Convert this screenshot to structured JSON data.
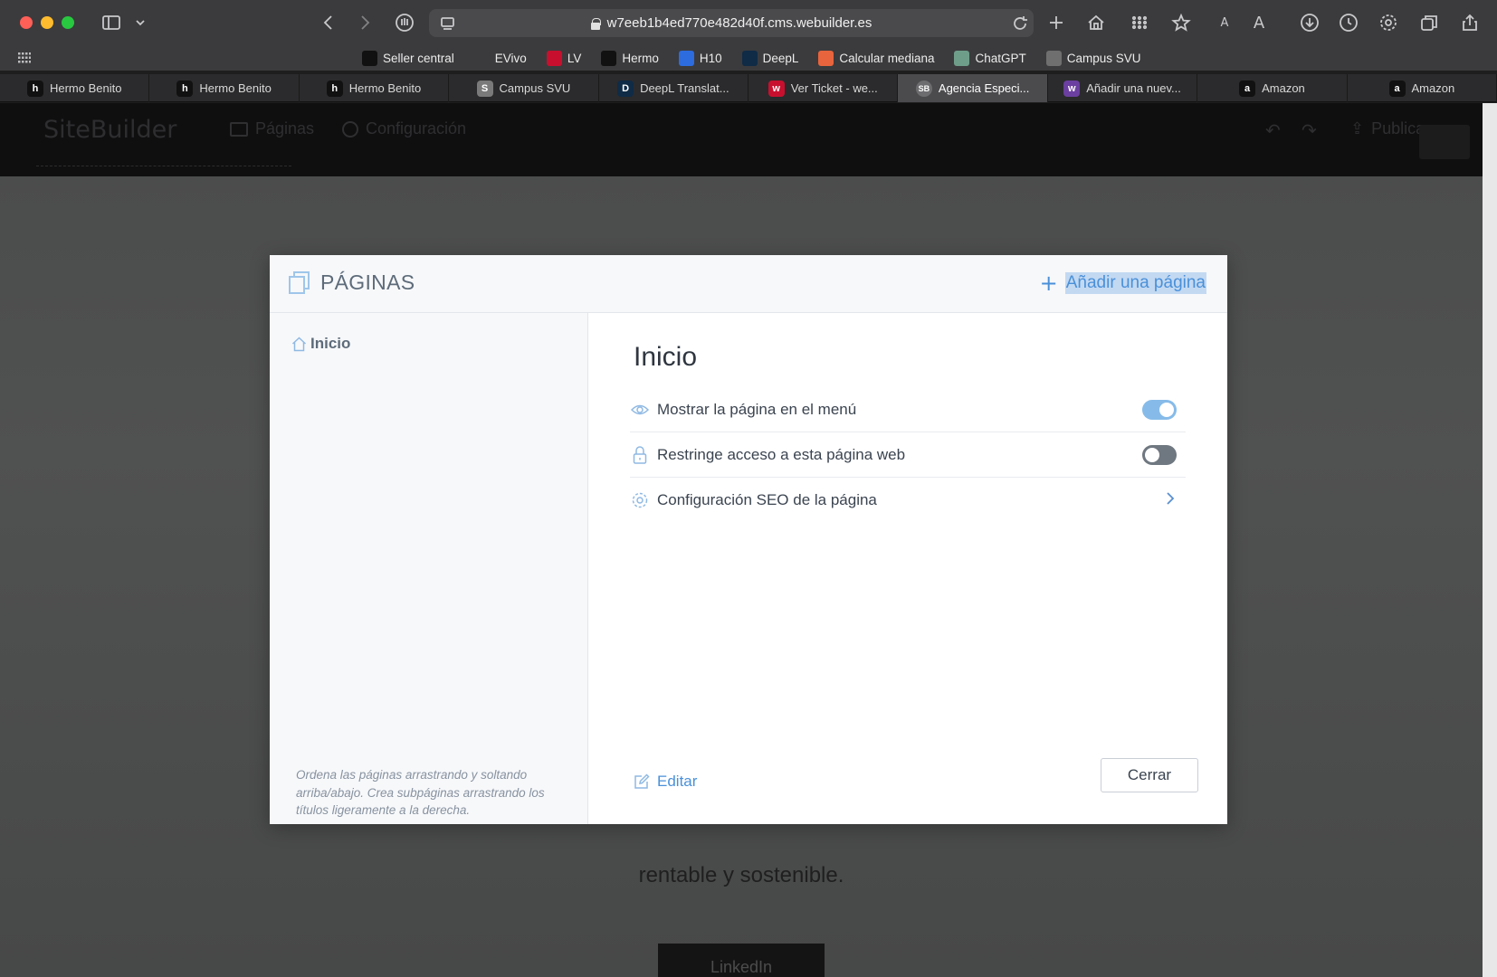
{
  "browser": {
    "url": "w7eeb1b4ed770e482d40f.cms.webuilder.es",
    "bookmarks": [
      {
        "label": "Seller central",
        "icon": "amazon-icon",
        "color": "#111111"
      },
      {
        "label": "EVivo",
        "icon": "globe-icon",
        "color": "#3b3b3d"
      },
      {
        "label": "LV",
        "icon": "lv-icon",
        "color": "#c8102e"
      },
      {
        "label": "Hermo",
        "icon": "hermo-icon",
        "color": "#111111"
      },
      {
        "label": "H10",
        "icon": "h10-icon",
        "color": "#2d6cdf"
      },
      {
        "label": "DeepL",
        "icon": "deepl-icon",
        "color": "#0f2b46"
      },
      {
        "label": "Calcular mediana",
        "icon": "calc-icon",
        "color": "#e8643c"
      },
      {
        "label": "ChatGPT",
        "icon": "chatgpt-icon",
        "color": "#6e9e8a"
      },
      {
        "label": "Campus SVU",
        "icon": "svu-icon",
        "color": "#6f6f6f"
      }
    ],
    "tabs": [
      {
        "label": "Hermo Benito",
        "icon": "h",
        "color": "#111111"
      },
      {
        "label": "Hermo Benito",
        "icon": "h",
        "color": "#111111"
      },
      {
        "label": "Hermo Benito",
        "icon": "h",
        "color": "#111111"
      },
      {
        "label": "Campus SVU",
        "icon": "S",
        "color": "#7a7a7a"
      },
      {
        "label": "DeepL Translat...",
        "icon": "D",
        "color": "#0f2b46"
      },
      {
        "label": "Ver Ticket - we...",
        "icon": "w",
        "color": "#c8102e"
      },
      {
        "label": "Agencia Especi...",
        "icon": "SB",
        "color": "#6d6d70"
      },
      {
        "label": "Añadir una nuev...",
        "icon": "w",
        "color": "#6b3fa0"
      },
      {
        "label": "Amazon",
        "icon": "a",
        "color": "#111111"
      },
      {
        "label": "Amazon",
        "icon": "a",
        "color": "#111111"
      }
    ]
  },
  "sitebuilder": {
    "logo": "SiteBuilder",
    "nav_pages": "Páginas",
    "nav_settings": "Configuración",
    "publish": "Publicar",
    "page_text": "rentable y sostenible.",
    "page_button": "LinkedIn"
  },
  "modal": {
    "title": "PÁGINAS",
    "add_page": "Añadir una página",
    "pages": [
      {
        "label": "Inicio"
      }
    ],
    "hint": "Ordena las páginas arrastrando y soltando arriba/abajo. Crea subpáginas arrastrando los títulos ligeramente a la derecha.",
    "detail_title": "Inicio",
    "options": {
      "show_in_menu": {
        "label": "Mostrar la página en el menú",
        "enabled": true
      },
      "restrict_access": {
        "label": "Restringe acceso a esta página web",
        "enabled": false
      },
      "seo": {
        "label": "Configuración SEO de la página"
      }
    },
    "edit": "Editar",
    "close": "Cerrar"
  }
}
